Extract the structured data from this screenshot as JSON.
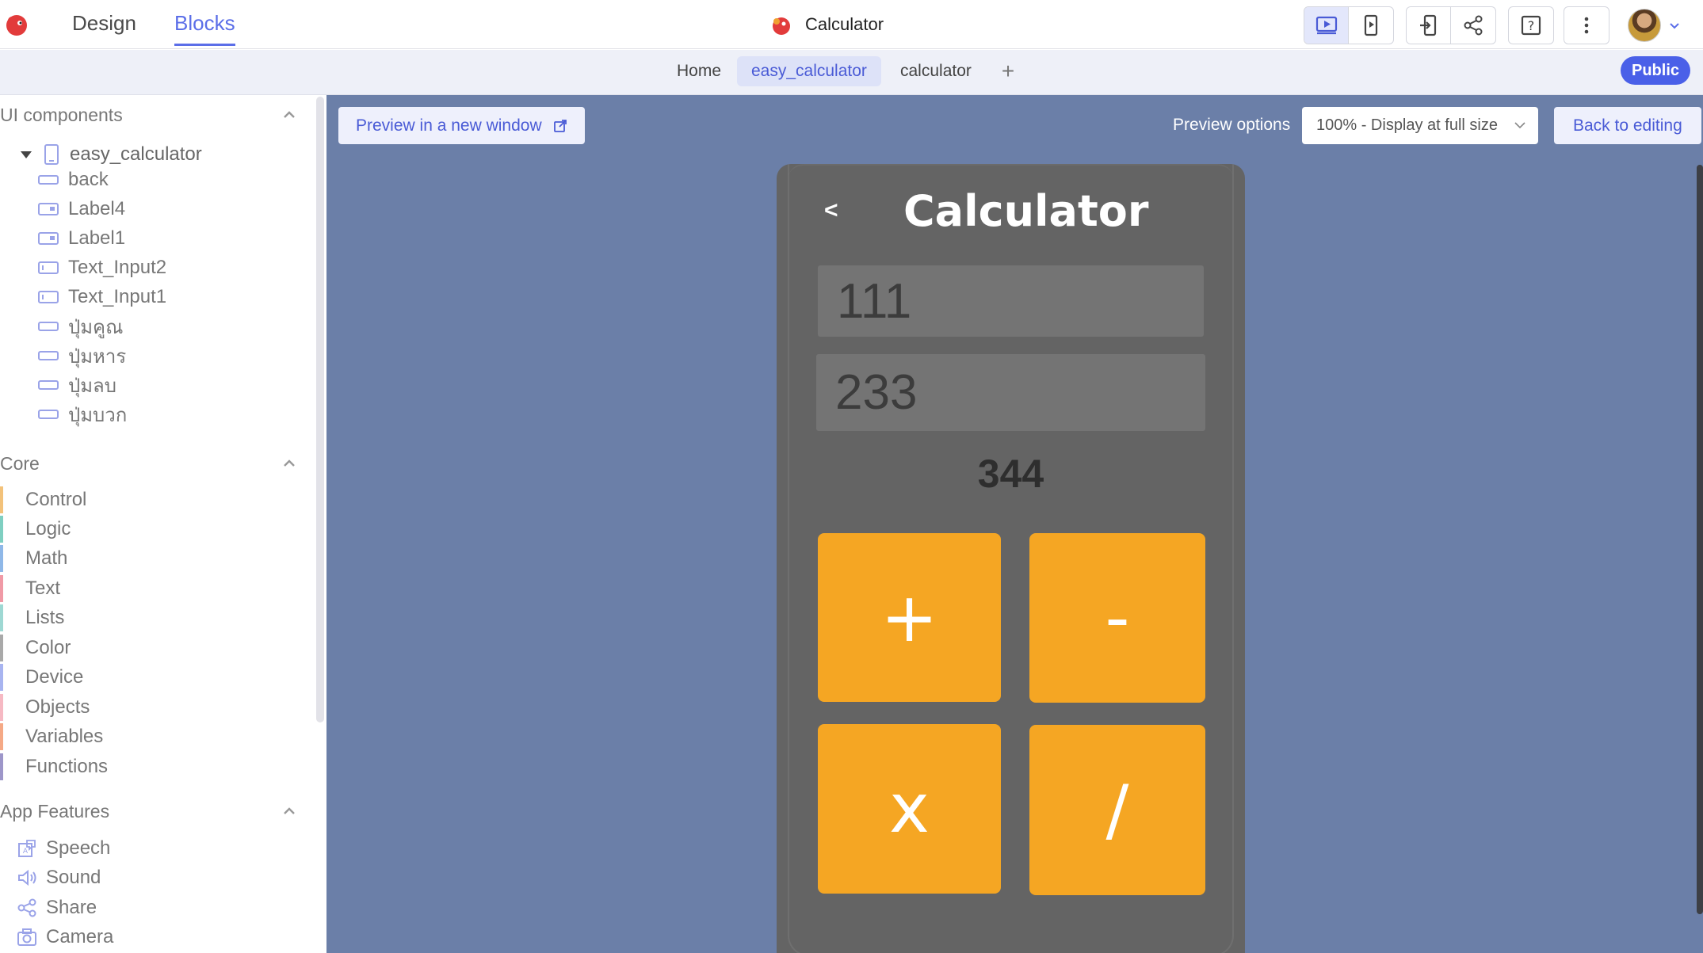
{
  "topbar": {
    "mode_tabs": [
      {
        "label": "Design"
      },
      {
        "label": "Blocks"
      }
    ],
    "app_title": "Calculator",
    "toolbar_icons": [
      "play-preview-icon",
      "phone-preview-icon",
      "export-icon",
      "share-icon",
      "help-icon",
      "more-icon"
    ],
    "accent_color": "#5b6ee8"
  },
  "screenbar": {
    "tabs": [
      {
        "label": "Home"
      },
      {
        "label": "easy_calculator"
      },
      {
        "label": "calculator"
      }
    ],
    "add_label": "+",
    "public_label": "Public"
  },
  "sidebar": {
    "ui_components": {
      "heading": "UI components",
      "root": "easy_calculator",
      "items": [
        {
          "label": "back",
          "icon": "button-icon"
        },
        {
          "label": "Label4",
          "icon": "label-icon"
        },
        {
          "label": "Label1",
          "icon": "label-icon"
        },
        {
          "label": "Text_Input2",
          "icon": "text-input-icon"
        },
        {
          "label": "Text_Input1",
          "icon": "text-input-icon"
        },
        {
          "label": "ปุ่มคูณ",
          "icon": "button-icon"
        },
        {
          "label": "ปุ่มหาร",
          "icon": "button-icon"
        },
        {
          "label": "ปุ่มลบ",
          "icon": "button-icon"
        },
        {
          "label": "ปุ่มบวก",
          "icon": "button-icon"
        }
      ]
    },
    "core": {
      "heading": "Core",
      "items": [
        {
          "label": "Control",
          "color": "#f3c27a"
        },
        {
          "label": "Logic",
          "color": "#7fcfc1"
        },
        {
          "label": "Math",
          "color": "#8fb8e8"
        },
        {
          "label": "Text",
          "color": "#f09aa6"
        },
        {
          "label": "Lists",
          "color": "#9ed8d3"
        },
        {
          "label": "Color",
          "color": "#a9a9a9"
        },
        {
          "label": "Device",
          "color": "#a8b4f0"
        },
        {
          "label": "Objects",
          "color": "#f6b9c3"
        },
        {
          "label": "Variables",
          "color": "#f5a986"
        },
        {
          "label": "Functions",
          "color": "#9d96c9"
        }
      ]
    },
    "app_features": {
      "heading": "App Features",
      "items": [
        {
          "label": "Speech",
          "icon": "speech-icon"
        },
        {
          "label": "Sound",
          "icon": "sound-icon"
        },
        {
          "label": "Share",
          "icon": "share-icon"
        },
        {
          "label": "Camera",
          "icon": "camera-icon"
        }
      ]
    }
  },
  "preview": {
    "open_window_label": "Preview in a new window",
    "options_label": "Preview options",
    "zoom_value": "100% - Display at full size",
    "back_label": "Back to editing",
    "background_color": "#6b7fa8"
  },
  "app": {
    "back_label": "<",
    "title": "Calculator",
    "input1_value": "111",
    "input2_value": "233",
    "result": "344",
    "buttons": {
      "plus": "+",
      "minus": "-",
      "multiply": "x",
      "divide": "/"
    },
    "button_color": "#f5a623",
    "screen_color": "#646464"
  }
}
